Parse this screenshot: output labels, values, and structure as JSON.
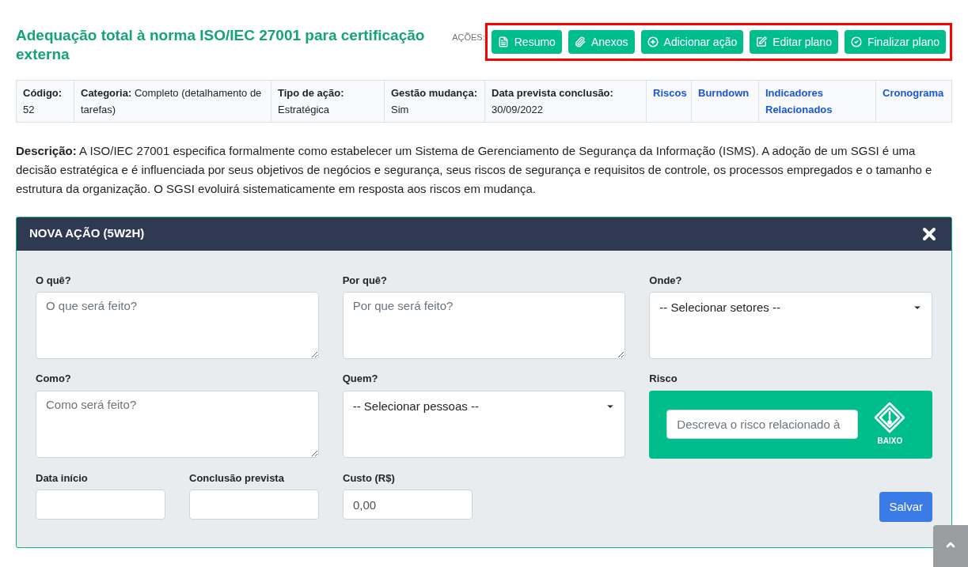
{
  "title": "Adequação total à norma ISO/IEC 27001 para certificação externa",
  "actions": {
    "label": "AÇÕES:",
    "buttons": [
      {
        "label": "Resumo"
      },
      {
        "label": "Anexos"
      },
      {
        "label": "Adicionar ação"
      },
      {
        "label": "Editar plano"
      },
      {
        "label": "Finalizar plano"
      }
    ]
  },
  "info": {
    "cells": [
      "**Código:** 52",
      "**Categoria:** Completo (detalhamento de tarefas)",
      "**Tipo de ação:** Estratégica",
      "**Gestão mudança:** Sim",
      "**Data prevista conclusão:** 30/09/2022"
    ],
    "links": [
      "Riscos",
      "Burndown",
      "Indicadores Relacionados",
      "Cronograma"
    ]
  },
  "description": {
    "label": "Descrição:",
    "text": "A ISO/IEC 27001 especifica formalmente como estabelecer um Sistema de Gerenciamento de Segurança da Informação (ISMS). A adoção de um SGSI é uma decisão estratégica e é influenciada por seus objetivos de negócios e segurança, seus riscos de segurança e requisitos de controle, os processos empregados e o tamanho e estrutura da organização. O SGSI evoluirá sistematicamente em resposta aos riscos em mudança."
  },
  "panel": {
    "title": "NOVA AÇÃO (5W2H)",
    "fields": [
      {
        "kind": "textarea",
        "label": "O quê?",
        "placeholder": "O que será feito?"
      },
      {
        "kind": "textarea",
        "label": "Por quê?",
        "placeholder": "Por que será feito?"
      },
      {
        "kind": "select",
        "label": "Onde?",
        "value": "-- Selecionar setores --"
      },
      {
        "kind": "textarea",
        "label": "Como?",
        "placeholder": "Como será feito?"
      },
      {
        "kind": "select",
        "label": "Quem?",
        "value": "-- Selecionar pessoas --"
      },
      {
        "kind": "risk",
        "label": "Risco",
        "placeholder": "Descreva o risco relacionado à",
        "level_label": "BAIXO"
      }
    ],
    "bottom_fields": [
      {
        "label": "Data início"
      },
      {
        "label": "Conclusão prevista"
      },
      {
        "label": "Custo (R$)",
        "value": "0,00"
      }
    ],
    "save": "Salvar"
  }
}
